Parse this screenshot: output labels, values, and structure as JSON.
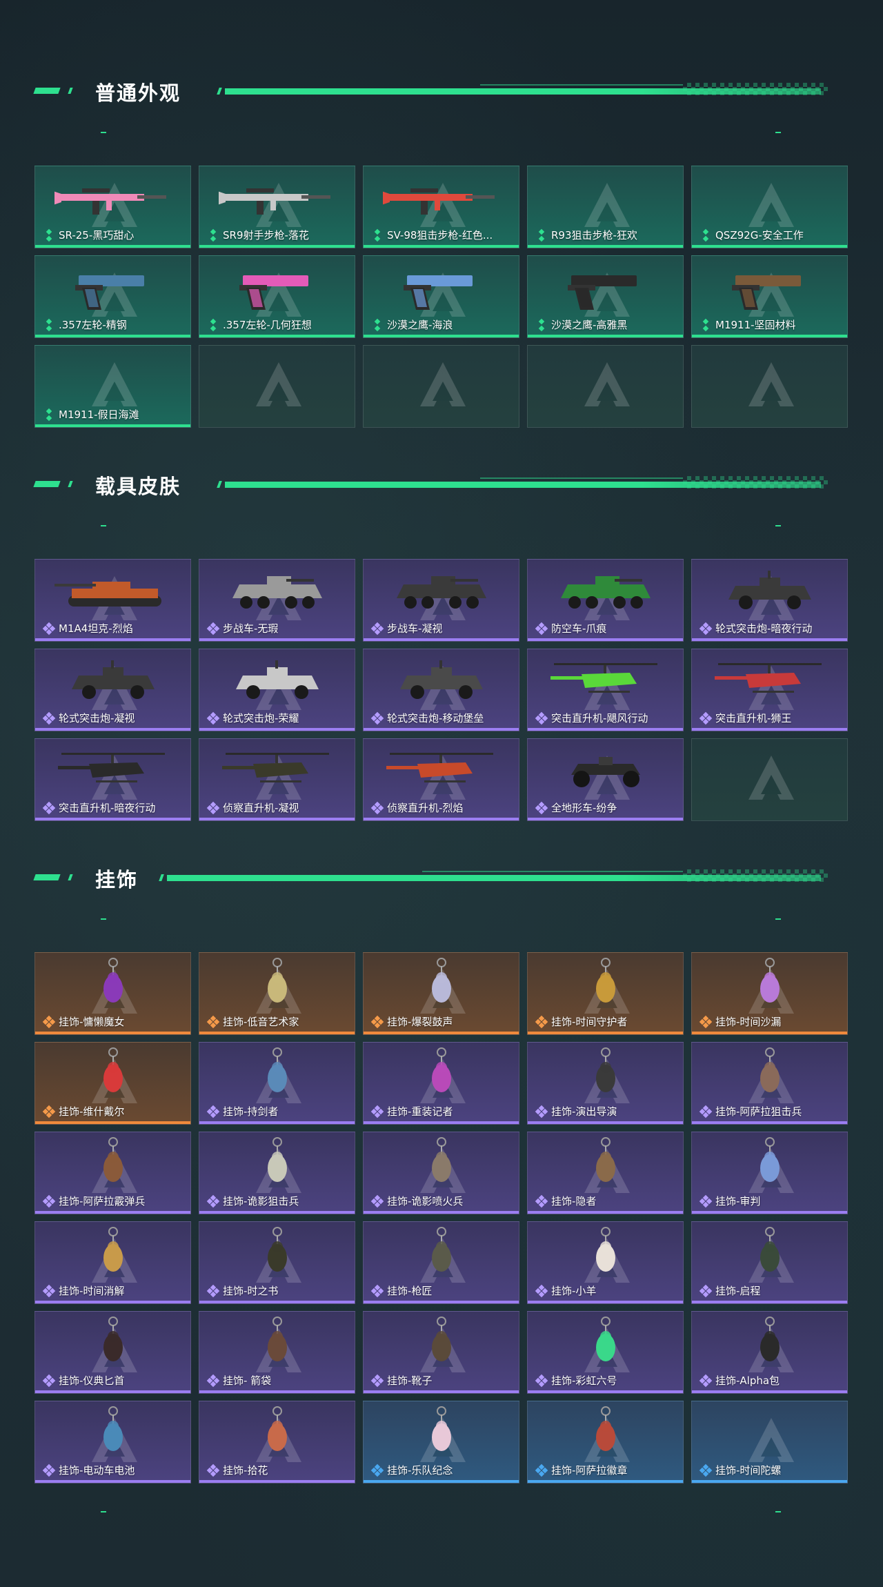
{
  "sections": [
    {
      "title": "普通外观",
      "items": [
        {
          "label": "SR-25-黑巧甜心",
          "rarity": "green",
          "kind": "rifle",
          "color": "#f08ab8"
        },
        {
          "label": "SR9射手步枪-落花",
          "rarity": "green",
          "kind": "rifle",
          "color": "#c8c8c8"
        },
        {
          "label": "SV-98狙击步枪-红色...",
          "rarity": "green",
          "kind": "rifle",
          "color": "#e0493c"
        },
        {
          "label": "R93狙击步枪-狂欢",
          "rarity": "green",
          "kind": "none",
          "color": ""
        },
        {
          "label": "QSZ92G-安全工作",
          "rarity": "green",
          "kind": "none",
          "color": ""
        },
        {
          "label": ".357左轮-精钢",
          "rarity": "green",
          "kind": "pistol",
          "color": "#4a7fa8"
        },
        {
          "label": ".357左轮-几何狂想",
          "rarity": "green",
          "kind": "pistol",
          "color": "#e35bb8"
        },
        {
          "label": "沙漠之鹰-海浪",
          "rarity": "green",
          "kind": "pistol",
          "color": "#6a9ad8"
        },
        {
          "label": "沙漠之鹰-高雅黑",
          "rarity": "green",
          "kind": "pistol",
          "color": "#2a2a2a"
        },
        {
          "label": "M1911-坚固材料",
          "rarity": "green",
          "kind": "pistol",
          "color": "#7a5a3a"
        },
        {
          "label": "M1911-假日海滩",
          "rarity": "green",
          "kind": "none",
          "color": ""
        },
        {
          "label": "",
          "rarity": "empty",
          "kind": "none",
          "color": ""
        },
        {
          "label": "",
          "rarity": "empty",
          "kind": "none",
          "color": ""
        },
        {
          "label": "",
          "rarity": "empty",
          "kind": "none",
          "color": ""
        },
        {
          "label": "",
          "rarity": "empty",
          "kind": "none",
          "color": ""
        }
      ]
    },
    {
      "title": "载具皮肤",
      "items": [
        {
          "label": "M1A4坦克-烈焰",
          "rarity": "purple",
          "kind": "tank",
          "color": "#c25a2a"
        },
        {
          "label": "步战车-无瑕",
          "rarity": "purple",
          "kind": "apc",
          "color": "#9a9a9a"
        },
        {
          "label": "步战车-凝视",
          "rarity": "purple",
          "kind": "apc",
          "color": "#3a3a3a"
        },
        {
          "label": "防空车-爪痕",
          "rarity": "purple",
          "kind": "apc",
          "color": "#2f8a3a"
        },
        {
          "label": "轮式突击炮-暗夜行动",
          "rarity": "purple",
          "kind": "car",
          "color": "#3a3a3a"
        },
        {
          "label": "轮式突击炮-凝视",
          "rarity": "purple",
          "kind": "car",
          "color": "#3a3a3a"
        },
        {
          "label": "轮式突击炮-荣耀",
          "rarity": "purple",
          "kind": "car",
          "color": "#c8c8c8"
        },
        {
          "label": "轮式突击炮-移动堡垒",
          "rarity": "purple",
          "kind": "car",
          "color": "#4a4a4a"
        },
        {
          "label": "突击直升机-飓风行动",
          "rarity": "purple",
          "kind": "heli",
          "color": "#5ad83a"
        },
        {
          "label": "突击直升机-狮王",
          "rarity": "purple",
          "kind": "heli",
          "color": "#c83a3a"
        },
        {
          "label": "突击直升机-暗夜行动",
          "rarity": "purple",
          "kind": "heli",
          "color": "#2a2a2a"
        },
        {
          "label": "侦察直升机-凝视",
          "rarity": "purple",
          "kind": "heli",
          "color": "#3a3a2a"
        },
        {
          "label": "侦察直升机-烈焰",
          "rarity": "purple",
          "kind": "heli",
          "color": "#c84a2a"
        },
        {
          "label": "全地形车-纷争",
          "rarity": "purple",
          "kind": "atv",
          "color": "#2a2a2a"
        },
        {
          "label": "",
          "rarity": "empty",
          "kind": "none",
          "color": ""
        }
      ]
    },
    {
      "title": "挂饰",
      "items": [
        {
          "label": "挂饰-慵懒魔女",
          "rarity": "orange",
          "kind": "charm",
          "color": "#8a3ab8"
        },
        {
          "label": "挂饰-低音艺术家",
          "rarity": "orange",
          "kind": "charm",
          "color": "#c8b87a"
        },
        {
          "label": "挂饰-爆裂鼓声",
          "rarity": "orange",
          "kind": "charm",
          "color": "#b8b8d8"
        },
        {
          "label": "挂饰-时间守护者",
          "rarity": "orange",
          "kind": "charm",
          "color": "#c89a3a"
        },
        {
          "label": "挂饰-时间沙漏",
          "rarity": "orange",
          "kind": "charm",
          "color": "#b87ad8"
        },
        {
          "label": "挂饰-维什戴尔",
          "rarity": "orange",
          "kind": "charm",
          "color": "#d83a3a"
        },
        {
          "label": "挂饰-持剑者",
          "rarity": "purple",
          "kind": "charm",
          "color": "#5a8ab8"
        },
        {
          "label": "挂饰-重装记者",
          "rarity": "purple",
          "kind": "charm",
          "color": "#b84ab8"
        },
        {
          "label": "挂饰-演出导演",
          "rarity": "purple",
          "kind": "charm",
          "color": "#3a3a3a"
        },
        {
          "label": "挂饰-阿萨拉狙击兵",
          "rarity": "purple",
          "kind": "charm",
          "color": "#8a6a5a"
        },
        {
          "label": "挂饰-阿萨拉霰弹兵",
          "rarity": "purple",
          "kind": "charm",
          "color": "#8a5a3a"
        },
        {
          "label": "挂饰-诡影狙击兵",
          "rarity": "purple",
          "kind": "charm",
          "color": "#c8c8b8"
        },
        {
          "label": "挂饰-诡影喷火兵",
          "rarity": "purple",
          "kind": "charm",
          "color": "#8a7a6a"
        },
        {
          "label": "挂饰-隐者",
          "rarity": "purple",
          "kind": "charm",
          "color": "#8a6a4a"
        },
        {
          "label": "挂饰-审判",
          "rarity": "purple",
          "kind": "charm",
          "color": "#7a9ad8"
        },
        {
          "label": "挂饰-时间消解",
          "rarity": "purple",
          "kind": "charm",
          "color": "#c89a4a"
        },
        {
          "label": "挂饰-时之书",
          "rarity": "purple",
          "kind": "charm",
          "color": "#3a3a2a"
        },
        {
          "label": "挂饰-枪匠",
          "rarity": "purple",
          "kind": "charm",
          "color": "#5a5a4a"
        },
        {
          "label": "挂饰-小羊",
          "rarity": "purple",
          "kind": "charm",
          "color": "#e8e0d8"
        },
        {
          "label": "挂饰-启程",
          "rarity": "purple",
          "kind": "charm",
          "color": "#3a4a3a"
        },
        {
          "label": "挂饰-仪典匕首",
          "rarity": "purple",
          "kind": "charm",
          "color": "#3a2a2a"
        },
        {
          "label": "挂饰- 箭袋",
          "rarity": "purple",
          "kind": "charm",
          "color": "#6a4a3a"
        },
        {
          "label": "挂饰-靴子",
          "rarity": "purple",
          "kind": "charm",
          "color": "#5a4a3a"
        },
        {
          "label": "挂饰-彩虹六号",
          "rarity": "purple",
          "kind": "charm",
          "color": "#3ad88a"
        },
        {
          "label": "挂饰-Alpha包",
          "rarity": "purple",
          "kind": "charm",
          "color": "#2a2a2a"
        },
        {
          "label": "挂饰-电动车电池",
          "rarity": "purple",
          "kind": "charm",
          "color": "#4a8ab8"
        },
        {
          "label": "挂饰-拾花",
          "rarity": "purple",
          "kind": "charm",
          "color": "#c86a4a"
        },
        {
          "label": "挂饰-乐队纪念",
          "rarity": "blue",
          "kind": "charm",
          "color": "#e8c8d8"
        },
        {
          "label": "挂饰-阿萨拉徽章",
          "rarity": "blue",
          "kind": "charm",
          "color": "#b84a3a"
        },
        {
          "label": "挂饰-时间陀螺",
          "rarity": "blue",
          "kind": "none",
          "color": ""
        }
      ]
    }
  ]
}
